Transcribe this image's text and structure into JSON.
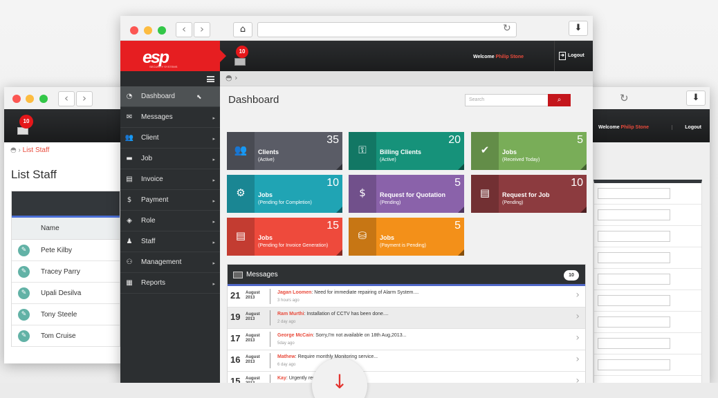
{
  "back_left": {
    "badge": "10",
    "breadcrumb": "List Staff",
    "title": "List Staff",
    "column_name": "Name",
    "staff": [
      "Pete Kilby",
      "Tracey Parry",
      "Upali Desilva",
      "Tony Steele",
      "Tom Cruise"
    ]
  },
  "back_right": {
    "welcome": "Welcome",
    "user": "Philip Stone",
    "logout": "Logout"
  },
  "browser": {
    "back": "‹",
    "forward": "›"
  },
  "header": {
    "logo_text": "esp",
    "logo_sub": "SECURITY SYSTEMS",
    "notification_count": "10",
    "welcome": "Welcome",
    "user": "Philip Stone",
    "logout": "Logout"
  },
  "sidebar": {
    "items": [
      {
        "label": "Dashboard",
        "icon": "dashboard-icon",
        "glyph": "◔"
      },
      {
        "label": "Messages",
        "icon": "messages-icon",
        "glyph": "✉"
      },
      {
        "label": "Client",
        "icon": "client-icon",
        "glyph": "👥"
      },
      {
        "label": "Job",
        "icon": "job-icon",
        "glyph": "▬"
      },
      {
        "label": "Invoice",
        "icon": "invoice-icon",
        "glyph": "▤"
      },
      {
        "label": "Payment",
        "icon": "payment-icon",
        "glyph": "$"
      },
      {
        "label": "Role",
        "icon": "role-icon",
        "glyph": "◈"
      },
      {
        "label": "Staff",
        "icon": "staff-icon",
        "glyph": "♟"
      },
      {
        "label": "Management",
        "icon": "management-icon",
        "glyph": "⚇"
      },
      {
        "label": "Reports",
        "icon": "reports-icon",
        "glyph": "▦"
      }
    ]
  },
  "dashboard": {
    "title": "Dashboard",
    "search_placeholder": "Search",
    "tiles": [
      {
        "title": "Clients",
        "sub": "(Active)",
        "count": "35",
        "color": "#5a5c66"
      },
      {
        "title": "Billing Clients",
        "sub": "(Active)",
        "count": "20",
        "color": "#16927a"
      },
      {
        "title": "Jobs",
        "sub": "(Received Today)",
        "count": "5",
        "color": "#79ad58"
      },
      {
        "title": "Jobs",
        "sub": "(Pending for Completion)",
        "count": "10",
        "color": "#20a4b4"
      },
      {
        "title": "Request for Quotation",
        "sub": "(Pending)",
        "count": "5",
        "color": "#8a62aa"
      },
      {
        "title": "Request for Job",
        "sub": "(Pending)",
        "count": "10",
        "color": "#8c3b3f"
      },
      {
        "title": "Jobs",
        "sub": "(Pending for Invoice Generation)",
        "count": "15",
        "color": "#ee4a3c"
      },
      {
        "title": "Jobs",
        "sub": "(Payment is Pending)",
        "count": "5",
        "color": "#f39019"
      }
    ]
  },
  "messages": {
    "title": "Messages",
    "count": "10",
    "items": [
      {
        "day": "21",
        "month": "August",
        "year": "2013",
        "name": "Jagan Loomen",
        "text": "Need for immediate repairing of Alarm System....",
        "ago": "3 hours ago"
      },
      {
        "day": "19",
        "month": "August",
        "year": "2013",
        "name": "Ram Murthi",
        "text": "Installation of CCTV has been done....",
        "ago": "2 day ago"
      },
      {
        "day": "17",
        "month": "August",
        "year": "2013",
        "name": "George McCain",
        "text": "Sorry,I'm not available on 18th Aug,2013...",
        "ago": "5day ago"
      },
      {
        "day": "16",
        "month": "August",
        "year": "2013",
        "name": "Mathew",
        "text": "Require monthly Monitoring service...",
        "ago": "6 day ago"
      },
      {
        "day": "15",
        "month": "August",
        "year": "2013",
        "name": "Kay",
        "text": "Urgently requi... service.....",
        "ago": "7 day ago"
      }
    ]
  }
}
